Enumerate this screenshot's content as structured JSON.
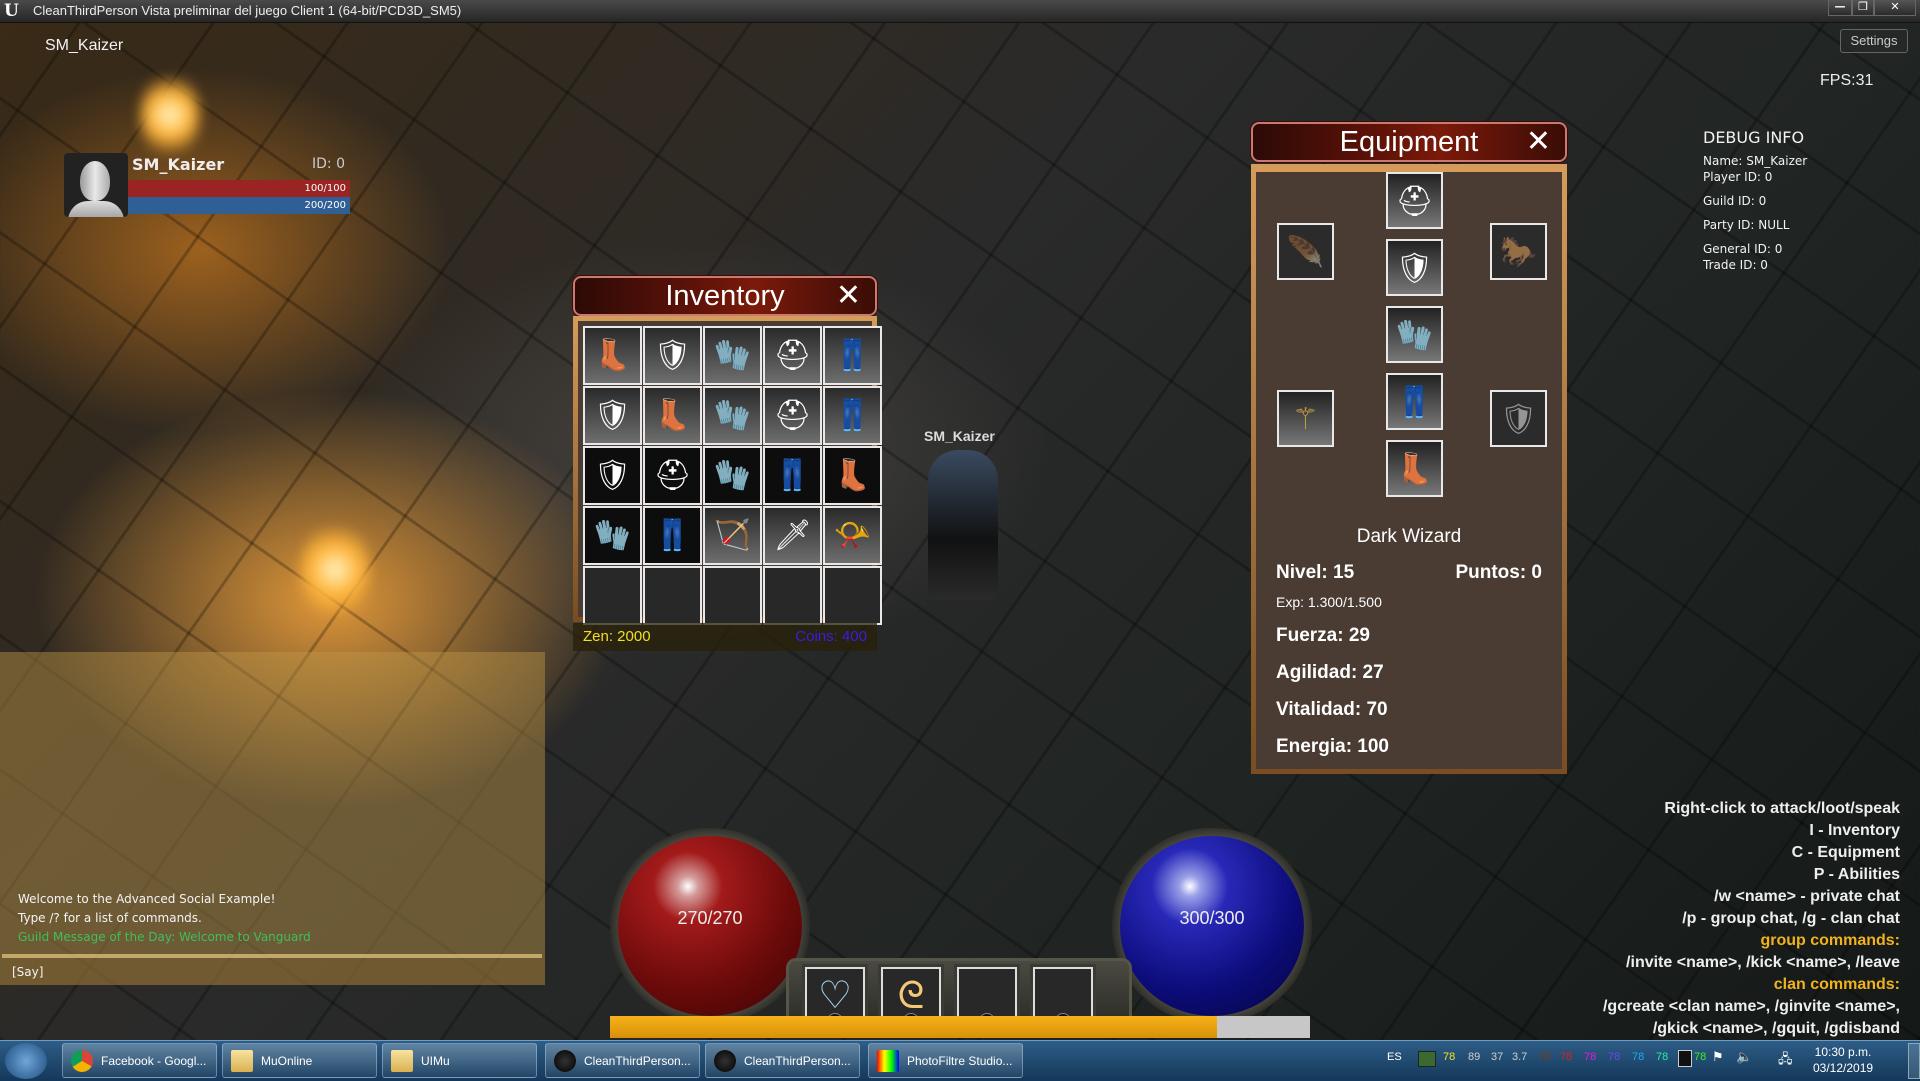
{
  "window": {
    "title": "CleanThirdPerson Vista preliminar del juego Client 1 (64-bit/PCD3D_SM5)",
    "minimize": "—",
    "restore": "❐",
    "close": "✕"
  },
  "hud": {
    "top_name": "SM_Kaizer",
    "settings_label": "Settings",
    "fps": "FPS:31",
    "world_nameplate": "SM_Kaizer"
  },
  "player_frame": {
    "name": "SM_Kaizer",
    "id": "ID: 0",
    "hp_text": "100/100",
    "hp_fraction": 1.0,
    "mp_text": "200/200",
    "mp_fraction": 1.0
  },
  "inventory": {
    "title": "Inventory",
    "close_icon": "✕",
    "zen": "Zen: 2000",
    "coins": "Coins: 400",
    "slots": [
      {
        "item": "boots-icon",
        "style": "gray",
        "glyph": "👢"
      },
      {
        "item": "armor-icon",
        "style": "gray",
        "glyph": "🛡"
      },
      {
        "item": "gloves-icon",
        "style": "gray",
        "glyph": "🧤"
      },
      {
        "item": "helm-icon",
        "style": "gray",
        "glyph": "⛑"
      },
      {
        "item": "pants-icon",
        "style": "gray",
        "glyph": "👖"
      },
      {
        "item": "armor-icon",
        "style": "gray",
        "glyph": "🛡"
      },
      {
        "item": "boots-icon",
        "style": "gray",
        "glyph": "👢"
      },
      {
        "item": "gloves-icon",
        "style": "gray",
        "glyph": "🧤"
      },
      {
        "item": "helm-icon",
        "style": "gray",
        "glyph": "⛑"
      },
      {
        "item": "pants-icon",
        "style": "gray",
        "glyph": "👖"
      },
      {
        "item": "armor-icon",
        "style": "dark",
        "glyph": "🛡"
      },
      {
        "item": "helm-icon",
        "style": "dark",
        "glyph": "⛑"
      },
      {
        "item": "gloves-icon",
        "style": "dark",
        "glyph": "🧤"
      },
      {
        "item": "pants-icon",
        "style": "dark",
        "glyph": "👖"
      },
      {
        "item": "boots-icon",
        "style": "dark",
        "glyph": "👢"
      },
      {
        "item": "gloves-icon",
        "style": "dark",
        "glyph": "🧤"
      },
      {
        "item": "pants-icon",
        "style": "dark",
        "glyph": "👖"
      },
      {
        "item": "bow-icon",
        "style": "gray",
        "glyph": "🏹"
      },
      {
        "item": "dagger-icon",
        "style": "gray",
        "glyph": "🗡"
      },
      {
        "item": "horn-icon",
        "style": "gray",
        "glyph": "📯"
      },
      {
        "item": "empty-slot",
        "style": "empty",
        "glyph": ""
      },
      {
        "item": "empty-slot",
        "style": "empty",
        "glyph": ""
      },
      {
        "item": "empty-slot",
        "style": "empty",
        "glyph": ""
      },
      {
        "item": "empty-slot",
        "style": "empty",
        "glyph": ""
      },
      {
        "item": "empty-slot",
        "style": "empty",
        "glyph": ""
      }
    ]
  },
  "equipment": {
    "title": "Equipment",
    "close_icon": "✕",
    "slots": {
      "helm": "⛑",
      "armor": "🛡",
      "gloves": "🧤",
      "pants": "👖",
      "boots": "👢",
      "wings": "🪶",
      "pet": "🐎",
      "weapon": "⚚",
      "shield": "🛡"
    },
    "class_name": "Dark Wizard",
    "level": "Nivel: 15",
    "points": "Puntos: 0",
    "exp": "Exp: 1.300/1.500",
    "strength": "Fuerza: 29",
    "agility": "Agilidad: 27",
    "vitality": "Vitalidad: 70",
    "energy": "Energia: 100"
  },
  "debug": {
    "heading": "DEBUG INFO",
    "name": "Name: SM_Kaizer",
    "player_id": "Player ID: 0",
    "guild_id": "Guild ID: 0",
    "party_id": "Party ID: NULL",
    "general_id": "General ID: 0",
    "trade_id": "Trade ID: 0"
  },
  "help": {
    "lines": [
      {
        "text": "Right-click to attack/loot/speak",
        "highlight": false
      },
      {
        "text": "I - Inventory",
        "highlight": false
      },
      {
        "text": "C - Equipment",
        "highlight": false
      },
      {
        "text": "P - Abilities",
        "highlight": false
      },
      {
        "text": "/w <name> - private chat",
        "highlight": false
      },
      {
        "text": "/p - group chat, /g - clan chat",
        "highlight": false
      },
      {
        "text": "group commands:",
        "highlight": true
      },
      {
        "text": "/invite <name>, /kick <name>, /leave",
        "highlight": false
      },
      {
        "text": "clan commands:",
        "highlight": true
      },
      {
        "text": "/gcreate <clan name>, /ginvite <name>,",
        "highlight": false
      },
      {
        "text": "/gkick <name>, /gquit, /gdisband",
        "highlight": false
      }
    ]
  },
  "chat": {
    "messages": [
      {
        "text": "Welcome to the Advanced Social Example!",
        "color": "#f4f4f4"
      },
      {
        "text": "Type /? for a list of commands.",
        "color": "#f4f4f4"
      },
      {
        "text": "Guild Message of the Day: Welcome to Vanguard",
        "color": "#3fbf5a"
      }
    ],
    "channel": "[Say]"
  },
  "orbs": {
    "health_text": "270/270",
    "health_fraction": 1.0,
    "mana_text": "300/300",
    "mana_fraction": 1.0
  },
  "skills": [
    {
      "key": "1",
      "icon": "heart-potion-icon",
      "glyph": "♡",
      "color": "#a8d4f2"
    },
    {
      "key": "2",
      "icon": "flame-swirl-icon",
      "glyph": "ᘓ",
      "color": "#f5c878"
    },
    {
      "key": "3",
      "icon": "empty-slot",
      "glyph": "",
      "color": "#fff"
    },
    {
      "key": "4",
      "icon": "empty-slot",
      "glyph": "",
      "color": "#fff"
    }
  ],
  "experience": {
    "fraction": 0.867
  },
  "taskbar": {
    "buttons": [
      {
        "label": "Facebook - Googl...",
        "icon": "chrome-icon"
      },
      {
        "label": "MuOnline",
        "icon": "folder-icon"
      },
      {
        "label": "UIMu",
        "icon": "folder-icon"
      },
      {
        "label": "CleanThirdPerson...",
        "icon": "unreal-icon"
      },
      {
        "label": "CleanThirdPerson...",
        "icon": "unreal-icon"
      },
      {
        "label": "PhotoFiltre Studio...",
        "icon": "photofiltre-icon"
      }
    ],
    "language": "ES",
    "tray_values": [
      {
        "text": "78",
        "color": "#f5e11e"
      },
      {
        "text": "89",
        "color": "#cfcfcf"
      },
      {
        "text": "37",
        "color": "#cfcfcf"
      },
      {
        "text": "3.7",
        "color": "#cfcfcf"
      },
      {
        "text": "78",
        "color": "#7a3d12"
      },
      {
        "text": "78",
        "color": "#e11c1c"
      },
      {
        "text": "78",
        "color": "#e01ed8"
      },
      {
        "text": "78",
        "color": "#6a48f0"
      },
      {
        "text": "78",
        "color": "#1ea8f0"
      },
      {
        "text": "78",
        "color": "#1ef0a8"
      },
      {
        "text": "78",
        "color": "#3ef01e"
      }
    ],
    "time": "10:30 p.m.",
    "date": "03/12/2019"
  }
}
